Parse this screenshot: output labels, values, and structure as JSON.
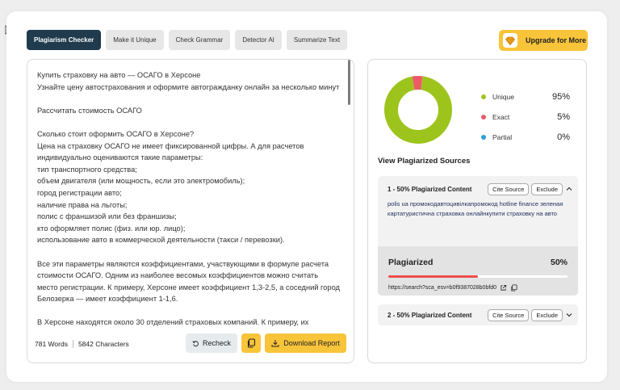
{
  "tabs": [
    {
      "label": "Plagiarism Checker"
    },
    {
      "label": "Make it Unique"
    },
    {
      "label": "Check Grammar"
    },
    {
      "label": "Detector AI"
    },
    {
      "label": "Summarize Text"
    }
  ],
  "upgrade_label": "Upgrade for More",
  "editor": {
    "paragraphs": [
      "Купить страховку на авто — ОСАГО в Херсоне\nУзнайте цену автострахования и оформите автогражданку онлайн за несколько минут",
      "Рассчитать стоимость ОСАГО",
      "Сколько стоит оформить ОСАГО в Херсоне?\nЦена на страховку ОСАГО не имеет фиксированной цифры. А для расчетов индивидуально оцениваются такие параметры:\nтип транспортного средства;\nобъем двигателя (или мощность, если это электромобиль);\nгород регистрации авто;\nналичие права на льготы;\nполис с франшизой или без франшизы;\nкто оформляет полис (физ. или юр. лицо);\nиспользование авто в коммерческой деятельности (такси / перевозки).",
      "Все эти параметры являются коэффициентами, участвующими в формуле расчета стоимости ОСАГО. Одним из наиболее весомых коэффициентов можно считать место регистрации. К примеру, Херсоне имеет коэффициент 1,3-2,5, а соседний город Белозерка — имеет коэффициент 1-1,6.",
      "В Херсоне находятся около 30 отделений страховых компаний. К примеру, их"
    ],
    "words": "781 Words",
    "characters": "5842 Characters",
    "recheck_label": "Recheck",
    "download_label": "Download Report"
  },
  "results": {
    "legend": [
      {
        "label": "Unique",
        "pct": "95%",
        "value": 95,
        "color": "#9dc41c"
      },
      {
        "label": "Exact",
        "pct": "5%",
        "value": 5,
        "color": "#ef5a68"
      },
      {
        "label": "Partial",
        "pct": "0%",
        "value": 0,
        "color": "#2d9fd6"
      }
    ],
    "sources_title": "View Plagiarized Sources",
    "cite_label": "Cite Source",
    "exclude_label": "Exclude",
    "sources": [
      {
        "name": "1 - 50% Plagiarized Content",
        "snippet": "polis ua промокодавтоцивілкапромокод hotline finance зеленая картатуристична страховка онлайнкупити страховку на авто",
        "plagiarized_label": "Plagiarized",
        "plagiarized_pct": "50%",
        "plagiarized_value": 50,
        "url": "https://search?sca_esv=b0f9387028b0bfd0"
      },
      {
        "name": "2 - 50% Plagiarized Content"
      }
    ]
  },
  "icons": {
    "upgrade": "diamond-icon",
    "recheck": "refresh-icon",
    "copy": "copy-icon",
    "download": "download-icon",
    "open": "external-link-icon",
    "chevron": "chevron-icon"
  }
}
